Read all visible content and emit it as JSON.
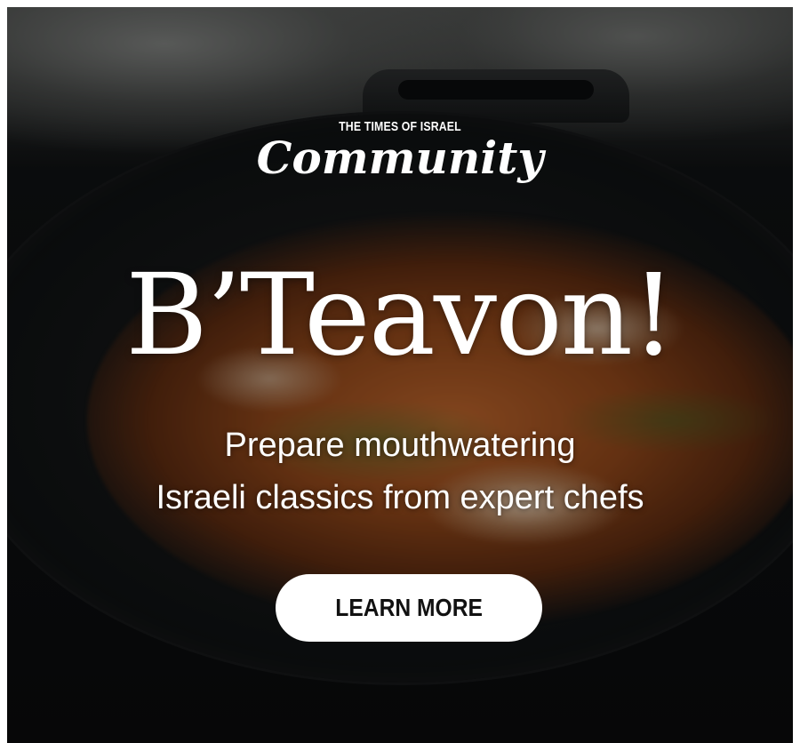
{
  "brand": {
    "publication": "THE TIMES OF ISRAEL",
    "section": "Community"
  },
  "headline": "B’Teavon!",
  "subheadline": {
    "line1": "Prepare mouthwatering",
    "line2": "Israeli classics from expert chefs"
  },
  "cta": {
    "label": "LEARN MORE"
  },
  "colors": {
    "text": "#ffffff",
    "button_bg": "#ffffff",
    "button_text": "#111111"
  },
  "background": {
    "subject": "shakshuka-in-cast-iron-pan-photo"
  }
}
